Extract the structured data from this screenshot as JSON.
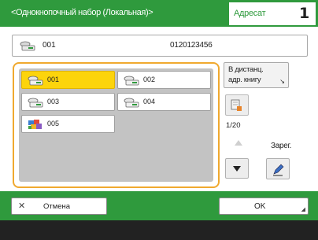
{
  "header": {
    "title": "<Однокнопочный набор (Локальная)>",
    "address_tab_label": "Адресат",
    "address_count": "1"
  },
  "entry": {
    "icon": "fax-icon",
    "number": "001",
    "value": "0120123456"
  },
  "list": {
    "items": [
      {
        "label": "001",
        "icon": "fax-icon",
        "selected": true
      },
      {
        "label": "002",
        "icon": "fax-icon",
        "selected": false
      },
      {
        "label": "003",
        "icon": "fax-icon",
        "selected": false
      },
      {
        "label": "004",
        "icon": "fax-icon",
        "selected": false
      },
      {
        "label": "005",
        "icon": "group-icon",
        "selected": false
      }
    ]
  },
  "side": {
    "remote_line1": "В дистанц.",
    "remote_line2": "адр. книгу",
    "page_indicator": "1/20",
    "register_label": "Зарег."
  },
  "footer": {
    "cancel_label": "Отмена",
    "ok_label": "OK"
  },
  "colors": {
    "header_green": "#2f9a3d",
    "selected_yellow": "#fcd40c",
    "focus_orange": "#f0a92f"
  }
}
